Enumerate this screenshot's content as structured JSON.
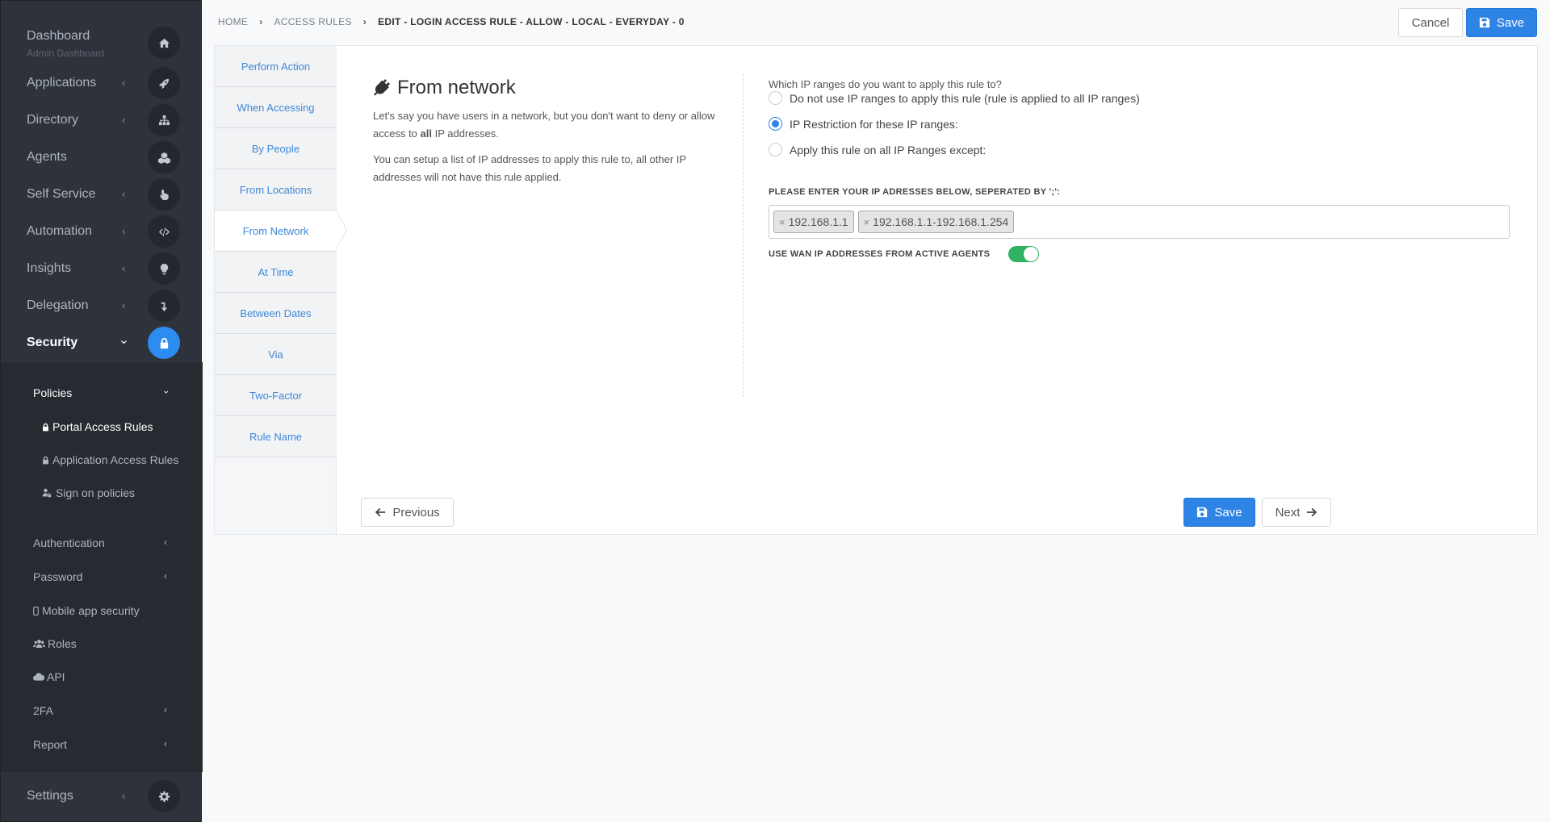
{
  "sidebar": {
    "dashboard": {
      "label": "Dashboard",
      "sub": "Admin Dashboard"
    },
    "items": [
      {
        "label": "Applications"
      },
      {
        "label": "Directory"
      },
      {
        "label": "Agents"
      },
      {
        "label": "Self Service"
      },
      {
        "label": "Automation"
      },
      {
        "label": "Insights"
      },
      {
        "label": "Delegation"
      },
      {
        "label": "Security"
      }
    ],
    "security_sub": {
      "policies": "Policies",
      "portal_access_rules": "Portal Access Rules",
      "application_access_rules": "Application Access Rules",
      "sign_on_policies": "Sign on policies",
      "authentication": "Authentication",
      "password": "Password",
      "mobile_app_security": "Mobile app security",
      "roles": "Roles",
      "api": "API",
      "twofa": "2FA",
      "report": "Report"
    },
    "settings": "Settings"
  },
  "breadcrumb": {
    "home": "HOME",
    "access_rules": "ACCESS RULES",
    "current": "EDIT - LOGIN ACCESS RULE - ALLOW - LOCAL - EVERYDAY - 0"
  },
  "header": {
    "cancel": "Cancel",
    "save": "Save"
  },
  "steps": [
    "Perform Action",
    "When Accessing",
    "By People",
    "From Locations",
    "From Network",
    "At Time",
    "Between Dates",
    "Via",
    "Two-Factor",
    "Rule Name"
  ],
  "active_step": "From Network",
  "section": {
    "title": "From network",
    "para1_a": "Let's say you have users in a network, but you don't want to deny or allow access to ",
    "para1_bold": "all",
    "para1_b": " IP addresses.",
    "para2": "You can setup a list of IP addresses to apply this rule to, all other IP addresses will not have this rule applied."
  },
  "form": {
    "question": "Which IP ranges do you want to apply this rule to?",
    "options": [
      "Do not use IP ranges to apply this rule (rule is applied to all IP ranges)",
      "IP Restriction for these IP ranges:",
      "Apply this rule on all IP Ranges except:"
    ],
    "selected_option": 1,
    "ip_label": "PLEASE ENTER YOUR IP ADRESSES BELOW, SEPERATED BY ';':",
    "ip_tags": [
      "192.168.1.1",
      "192.168.1.1-192.168.1.254"
    ],
    "wan_label": "USE WAN IP ADDRESSES FROM ACTIVE AGENTS",
    "wan_enabled": true
  },
  "footer": {
    "previous": "Previous",
    "save": "Save",
    "next": "Next"
  },
  "colors": {
    "primary": "#2d84e5",
    "sidebar": "#2d323b",
    "toggle_on": "#2fb261"
  }
}
